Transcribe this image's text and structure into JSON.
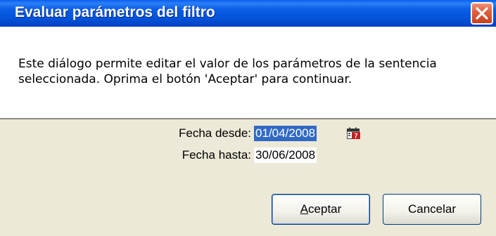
{
  "dialog": {
    "title": "Evaluar parámetros del filtro",
    "description": "Este diálogo permite editar el valor de los parámetros de la sentencia seleccionada. Oprima el botón 'Aceptar' para continuar."
  },
  "fields": {
    "fecha_desde": {
      "label": "Fecha desde:",
      "value": "01/04/2008"
    },
    "fecha_hasta": {
      "label": "Fecha hasta:",
      "value": "30/06/2008"
    }
  },
  "buttons": {
    "accept": "Aceptar",
    "cancel": "Cancelar"
  },
  "icons": {
    "close": "close-icon",
    "calendar": "calendar-icon"
  },
  "colors": {
    "titlebar": "#0452d8",
    "selection": "#316ac5",
    "close_button": "#e0603f",
    "dialog_face": "#ece9d8"
  }
}
